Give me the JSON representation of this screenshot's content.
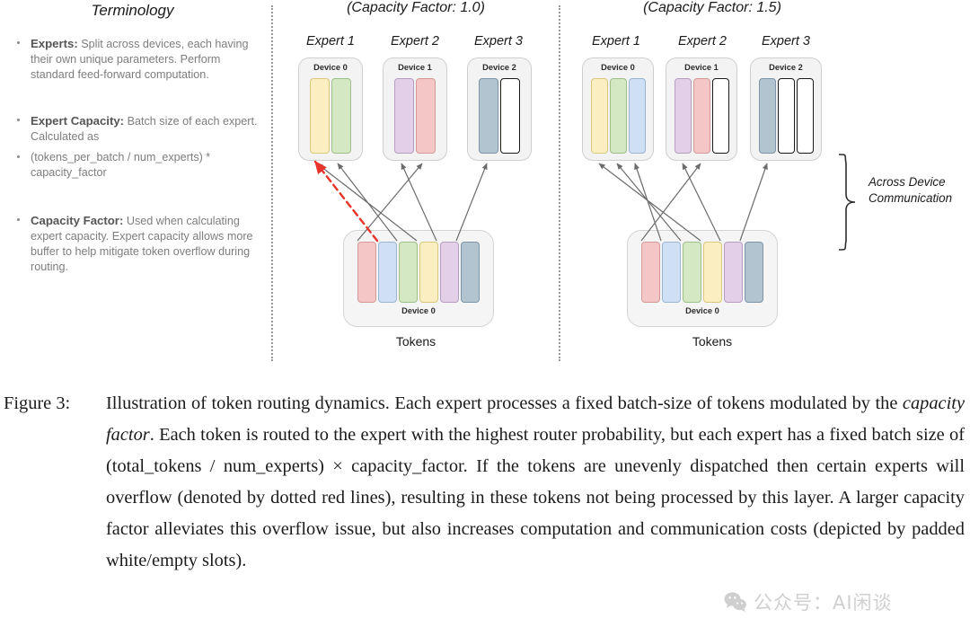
{
  "terminology": {
    "title": "Terminology",
    "items": [
      {
        "term": "Experts:",
        "text": " Split across devices, each having their own unique parameters. Perform standard feed-forward computation."
      },
      {
        "term": "Expert Capacity:",
        "text": " Batch size of each expert. Calculated as"
      },
      {
        "term": "",
        "text": "(tokens_per_batch / num_experts) * capacity_factor"
      },
      {
        "term": "Capacity Factor:",
        "text": " Used when calculating expert capacity. Expert capacity allows more buffer to help mitigate token overflow during routing."
      }
    ]
  },
  "panels": [
    {
      "title": "(Capacity Factor: 1.0)",
      "experts": [
        {
          "label": "Expert 1",
          "device": "Device 0",
          "slots": [
            "#fbeec0",
            "#d4e8c4"
          ]
        },
        {
          "label": "Expert 2",
          "device": "Device 1",
          "slots": [
            "#e3cfe8",
            "#f5c6c6"
          ]
        },
        {
          "label": "Expert 3",
          "device": "Device 2",
          "slots": [
            "#b3c4d1",
            "#ffffff"
          ]
        }
      ],
      "tokens": {
        "device": "Device 0",
        "caption": "Tokens",
        "colors": [
          "#f5c6c6",
          "#cfe0f5",
          "#d4e8c4",
          "#fbeec0",
          "#e3cfe8",
          "#b3c4d1"
        ]
      },
      "overflow": true
    },
    {
      "title": "(Capacity Factor: 1.5)",
      "experts": [
        {
          "label": "Expert 1",
          "device": "Device 0",
          "slots": [
            "#fbeec0",
            "#d4e8c4",
            "#cfe0f5"
          ]
        },
        {
          "label": "Expert 2",
          "device": "Device 1",
          "slots": [
            "#e3cfe8",
            "#f5c6c6",
            "#ffffff"
          ]
        },
        {
          "label": "Expert 3",
          "device": "Device 2",
          "slots": [
            "#b3c4d1",
            "#ffffff",
            "#ffffff"
          ]
        }
      ],
      "tokens": {
        "device": "Device 0",
        "caption": "Tokens",
        "colors": [
          "#f5c6c6",
          "#cfe0f5",
          "#d4e8c4",
          "#fbeec0",
          "#e3cfe8",
          "#b3c4d1"
        ]
      },
      "overflow": false
    }
  ],
  "communication_label": "Across Device Communication",
  "caption": {
    "label": "Figure 3:",
    "part1": "Illustration of token routing dynamics. Each expert processes a fixed batch-size of tokens modulated by the ",
    "emphasis": "capacity factor",
    "part2": ". Each token is routed to the expert with the highest router probability, but each expert has a fixed batch size of (total_tokens / num_experts) × capacity_factor. If the tokens are unevenly dispatched then certain experts will overflow (denoted by dotted red lines), resulting in these tokens not being processed by this layer. A larger capacity factor alleviates this overflow issue, but also increases computation and communication costs (depicted by padded white/empty slots)."
  },
  "watermark": {
    "text": "公众号：AI闲谈"
  },
  "colors": {
    "arrow_gray": "#6b6b6b",
    "overflow_red": "#e8332a",
    "box_fill": "#f3f3f3",
    "box_border": "#cfcfcf"
  }
}
